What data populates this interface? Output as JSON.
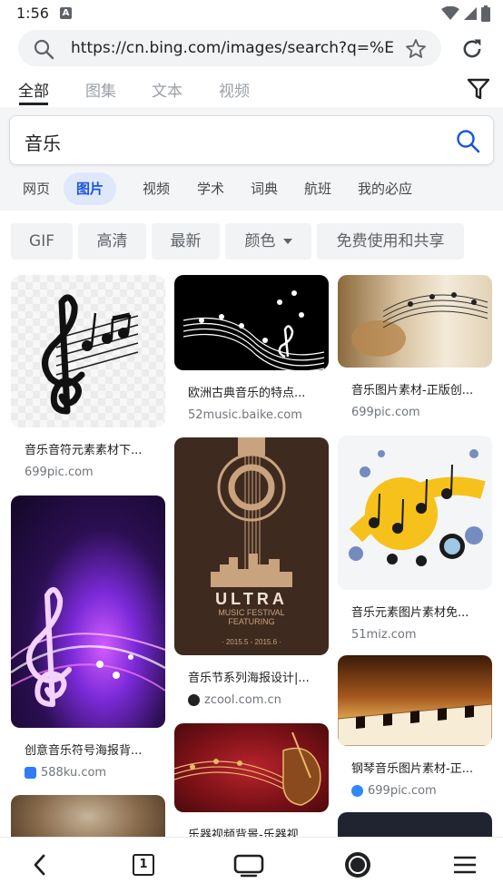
{
  "status_bar": {
    "time": "1:56",
    "notification_icon": "A"
  },
  "url_bar": {
    "url": "https://cn.bing.com/images/search?q=%E"
  },
  "top_tabs": [
    {
      "label": "全部",
      "active": true
    },
    {
      "label": "图集",
      "active": false
    },
    {
      "label": "文本",
      "active": false
    },
    {
      "label": "视频",
      "active": false
    }
  ],
  "search": {
    "query": "音乐"
  },
  "verticals": [
    {
      "label": "网页",
      "active": false
    },
    {
      "label": "图片",
      "active": true
    },
    {
      "label": "视频",
      "active": false
    },
    {
      "label": "学术",
      "active": false
    },
    {
      "label": "词典",
      "active": false
    },
    {
      "label": "航班",
      "active": false
    },
    {
      "label": "我的必应",
      "active": false
    }
  ],
  "filter_chips": [
    {
      "label": "GIF"
    },
    {
      "label": "高清"
    },
    {
      "label": "最新"
    },
    {
      "label": "颜色"
    },
    {
      "label": "免费使用和共享"
    }
  ],
  "results": [
    {
      "title": "音乐音符元素素材下...",
      "source": "699pic.com"
    },
    {
      "title": "创意音乐符号海报背...",
      "source": "588ku.com"
    },
    {
      "title": "",
      "source": ""
    },
    {
      "title": "欧洲古典音乐的特点...",
      "source": "52music.baike.com"
    },
    {
      "title": "音乐节系列海报设计|...",
      "source": "zcool.com.cn"
    },
    {
      "title": "乐器视频背景-乐器视...",
      "source": ""
    },
    {
      "title": "音乐图片素材-正版创...",
      "source": "699pic.com"
    },
    {
      "title": "音乐元素图片素材免...",
      "source": "51miz.com"
    },
    {
      "title": "钢琴音乐图片素材-正...",
      "source": "699pic.com"
    },
    {
      "title": "",
      "source": ""
    }
  ],
  "poster": {
    "headline": "ULTRA",
    "subline": "MUSIC FESTIVAL",
    "subline2": "FEATURING",
    "dates": "· 2015.5 - 2015.6 ·"
  },
  "bottom_nav": {
    "tab_count": "1"
  },
  "colors": {
    "accent": "#1a56db",
    "chip_bg": "#f1f3f4",
    "active_vertical_bg": "#dfe7fb"
  }
}
